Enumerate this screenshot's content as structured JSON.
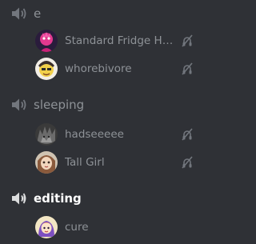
{
  "channels": [
    {
      "name": "e",
      "users": [
        {
          "name": "Standard Fridge Hei...",
          "avatar_icon": "pink-character-avatar",
          "deafened": true
        },
        {
          "name": "whorebivore",
          "avatar_icon": "yellow-cartoon-avatar",
          "deafened": true
        }
      ]
    },
    {
      "name": "sleeping",
      "users": [
        {
          "name": "hadseeeee",
          "avatar_icon": "grey-spiky-avatar",
          "deafened": true
        },
        {
          "name": "Tall Girl",
          "avatar_icon": "doll-face-avatar",
          "deafened": true
        }
      ]
    },
    {
      "name": "editing",
      "active": true,
      "users": [
        {
          "name": "cure",
          "avatar_icon": "purple-drawing-avatar",
          "deafened": false
        }
      ]
    }
  ],
  "colors": {
    "background": "#2f3136",
    "text_muted": "#8e9297",
    "text_active": "#ffffff",
    "icon_muted": "#72767d"
  }
}
